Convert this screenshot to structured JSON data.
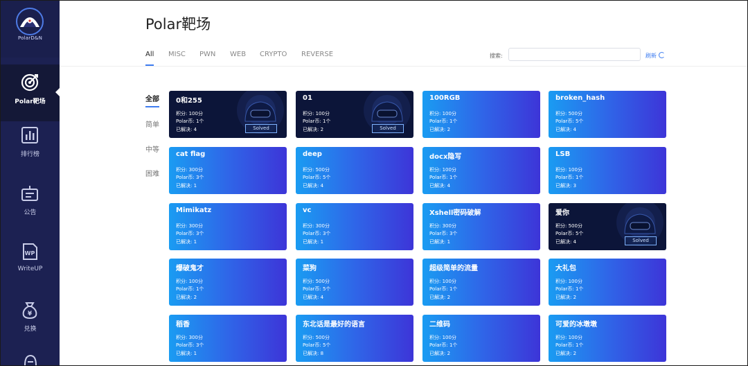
{
  "sidebar": {
    "logo_text": "PolarD&N",
    "items": [
      {
        "label": "Polar靶场",
        "icon": "target-icon",
        "active": true
      },
      {
        "label": "排行榜",
        "icon": "bar-chart-icon",
        "active": false
      },
      {
        "label": "公告",
        "icon": "announcement-icon",
        "active": false
      },
      {
        "label": "WriteUP",
        "icon": "writeup-icon",
        "active": false
      },
      {
        "label": "兑换",
        "icon": "yen-bag-icon",
        "active": false
      }
    ]
  },
  "header": {
    "title": "Polar靶场",
    "tabs": [
      "All",
      "MISC",
      "PWN",
      "WEB",
      "CRYPTO",
      "REVERSE"
    ],
    "active_tab": "All",
    "search_label": "搜索:",
    "search_value": "",
    "refresh_label": "刷新"
  },
  "filters": [
    "全部",
    "简单",
    "中等",
    "困难"
  ],
  "active_filter": "全部",
  "card_labels": {
    "score": "积分:",
    "coins": "Polar币:",
    "solved": "已解决:",
    "solved_badge": "Solved"
  },
  "cards": [
    {
      "title": "0和255",
      "score": "100分",
      "coins": "1个",
      "solved_count": "4",
      "solved": true
    },
    {
      "title": "01",
      "score": "100分",
      "coins": "1个",
      "solved_count": "2",
      "solved": true
    },
    {
      "title": "100RGB",
      "score": "100分",
      "coins": "1个",
      "solved_count": "2",
      "solved": false
    },
    {
      "title": "broken_hash",
      "score": "500分",
      "coins": "5个",
      "solved_count": "4",
      "solved": false
    },
    {
      "title": "cat flag",
      "score": "300分",
      "coins": "3个",
      "solved_count": "1",
      "solved": false
    },
    {
      "title": "deep",
      "score": "500分",
      "coins": "5个",
      "solved_count": "4",
      "solved": false
    },
    {
      "title": "docx隐写",
      "score": "100分",
      "coins": "1个",
      "solved_count": "4",
      "solved": false
    },
    {
      "title": "LSB",
      "score": "100分",
      "coins": "1个",
      "solved_count": "3",
      "solved": false
    },
    {
      "title": "Mimikatz",
      "score": "300分",
      "coins": "3个",
      "solved_count": "1",
      "solved": false
    },
    {
      "title": "vc",
      "score": "300分",
      "coins": "3个",
      "solved_count": "1",
      "solved": false
    },
    {
      "title": "Xshell密码破解",
      "score": "300分",
      "coins": "3个",
      "solved_count": "1",
      "solved": false
    },
    {
      "title": "爱你",
      "score": "500分",
      "coins": "5个",
      "solved_count": "4",
      "solved": true
    },
    {
      "title": "爆破鬼才",
      "score": "100分",
      "coins": "1个",
      "solved_count": "2",
      "solved": false
    },
    {
      "title": "菜狗",
      "score": "500分",
      "coins": "5个",
      "solved_count": "4",
      "solved": false
    },
    {
      "title": "超级简单的流量",
      "score": "100分",
      "coins": "1个",
      "solved_count": "2",
      "solved": false
    },
    {
      "title": "大礼包",
      "score": "100分",
      "coins": "1个",
      "solved_count": "2",
      "solved": false
    },
    {
      "title": "稻香",
      "score": "300分",
      "coins": "3个",
      "solved_count": "1",
      "solved": false
    },
    {
      "title": "东北话是最好的语言",
      "score": "500分",
      "coins": "5个",
      "solved_count": "8",
      "solved": false
    },
    {
      "title": "二维码",
      "score": "100分",
      "coins": "1个",
      "solved_count": "2",
      "solved": false
    },
    {
      "title": "可爱的冰墩墩",
      "score": "100分",
      "coins": "1个",
      "solved_count": "2",
      "solved": false
    }
  ],
  "colors": {
    "sidebar_bg": "#1c2152",
    "accent": "#3d7cf0",
    "card_gradient_start": "#1a9cf2",
    "card_gradient_end": "#3d35d8",
    "solved_card_bg": "#0c1539"
  }
}
